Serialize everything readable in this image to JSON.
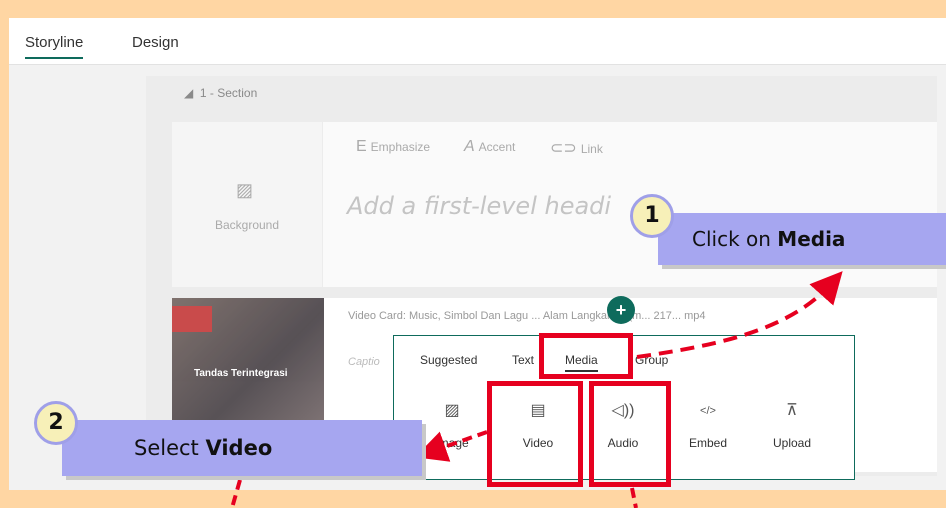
{
  "tabs": {
    "storyline": "Storyline",
    "design": "Design"
  },
  "section": {
    "label": "1 - Section"
  },
  "toolbar": {
    "emphasize": "Emphasize",
    "accent": "Accent",
    "link": "Link"
  },
  "hero": {
    "background_label": "Background",
    "heading_placeholder": "Add a first-level headi"
  },
  "video_card": {
    "title": "Video Card: Music, Simbol Dan Lagu ... Alam Langkahan (m... 217... mp4",
    "caption_placeholder": "Captio",
    "thumb_text": "Tandas Terintegrasi"
  },
  "popup": {
    "tabs": [
      "Suggested",
      "Text",
      "Media",
      "Group"
    ],
    "active_tab": "Media",
    "items": [
      {
        "label": "Image",
        "icon": "image-icon"
      },
      {
        "label": "Video",
        "icon": "film-icon"
      },
      {
        "label": "Audio",
        "icon": "speaker-icon"
      },
      {
        "label": "Embed",
        "icon": "code-icon"
      },
      {
        "label": "Upload",
        "icon": "upload-icon"
      }
    ]
  },
  "annotations": {
    "step1_number": "1",
    "step1_text": "Click on ",
    "step1_bold": "Media",
    "step2_number": "2",
    "step2_text": "Select ",
    "step2_bold": "Video"
  },
  "colors": {
    "accent": "#0e6b5c",
    "highlight": "#e6001f",
    "callout": "#a6a6f0",
    "frame": "#ffd6a3"
  }
}
